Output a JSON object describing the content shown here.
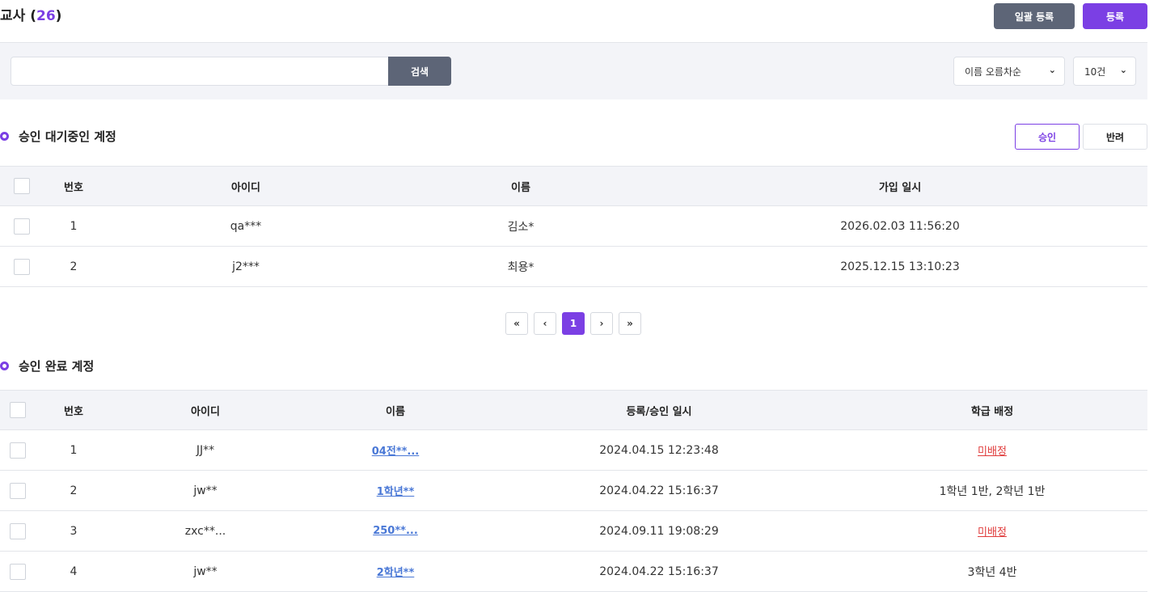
{
  "header": {
    "title": "교사",
    "count": "26",
    "bulk_register_label": "일괄 등록",
    "register_label": "등록"
  },
  "search": {
    "placeholder": "",
    "value": "",
    "button_label": "검색",
    "sort_selected": "이름 오름차순",
    "page_size_selected": "10건"
  },
  "pending": {
    "title": "승인 대기중인 계정",
    "approve_label": "승인",
    "reject_label": "반려",
    "columns": [
      "번호",
      "아이디",
      "이름",
      "가입 일시"
    ],
    "rows": [
      {
        "no": "1",
        "id": "qa***",
        "name": "김소*",
        "date": "2026.02.03 11:56:20"
      },
      {
        "no": "2",
        "id": "j2***",
        "name": "최용*",
        "date": "2025.12.15 13:10:23"
      }
    ]
  },
  "pagination": {
    "first": "«",
    "prev": "‹",
    "current": "1",
    "next": "›",
    "last": "»"
  },
  "approved": {
    "title": "승인 완료 계정",
    "columns": [
      "번호",
      "아이디",
      "이름",
      "등록/승인 일시",
      "학급 배정"
    ],
    "rows": [
      {
        "no": "1",
        "id": "JJ**",
        "name": "04전**...",
        "date": "2024.04.15 12:23:48",
        "class": "미배정"
      },
      {
        "no": "2",
        "id": "jw**",
        "name": "1학년**",
        "date": "2024.04.22 15:16:37",
        "class": "1학년 1반, 2학년 1반"
      },
      {
        "no": "3",
        "id": "zxc**...",
        "name": "250**...",
        "date": "2024.09.11 19:08:29",
        "class": "미배정"
      },
      {
        "no": "4",
        "id": "jw**",
        "name": "2학년**",
        "date": "2024.04.22 15:16:37",
        "class": "3학년 4반"
      }
    ]
  },
  "colors": {
    "accent": "#7b3fe4",
    "slate": "#5d6577",
    "link": "#4a78d6",
    "unassigned": "#e03c3c"
  },
  "icons": {
    "chevron": "chevron-down-icon",
    "section_marker": "ring-icon"
  }
}
